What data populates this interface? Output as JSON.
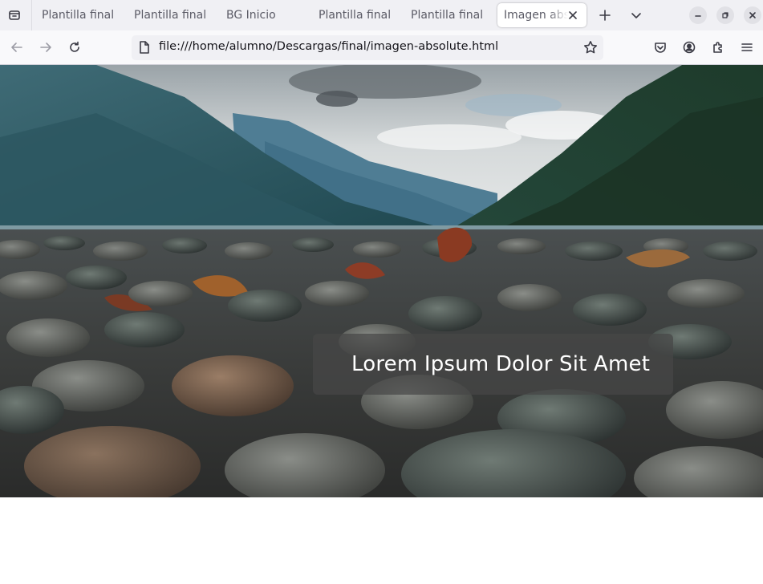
{
  "browser": {
    "tabs": [
      {
        "title": "Plantilla final",
        "active": false
      },
      {
        "title": "Plantilla final",
        "active": false
      },
      {
        "title": "BG Inicio",
        "active": false
      },
      {
        "title": "Plantilla final",
        "active": false
      },
      {
        "title": "Plantilla final",
        "active": false
      },
      {
        "title": "Imagen absolute",
        "active": true
      }
    ],
    "url": "file:///home/alumno/Descargas/final/imagen-absolute.html",
    "icons": {
      "tab_list": "tab-list-icon",
      "new_tab": "plus-icon",
      "all_tabs": "chevron-down-icon",
      "minimize": "minimize-icon",
      "restore": "restore-icon",
      "close": "close-icon",
      "back": "back-arrow-icon",
      "forward": "forward-arrow-icon",
      "reload": "reload-icon",
      "page": "page-icon",
      "bookmark": "star-icon",
      "pocket": "pocket-icon",
      "account": "account-icon",
      "extensions": "puzzle-icon",
      "menu": "hamburger-icon"
    }
  },
  "page": {
    "caption": "Lorem Ipsum Dolor Sit Amet"
  }
}
